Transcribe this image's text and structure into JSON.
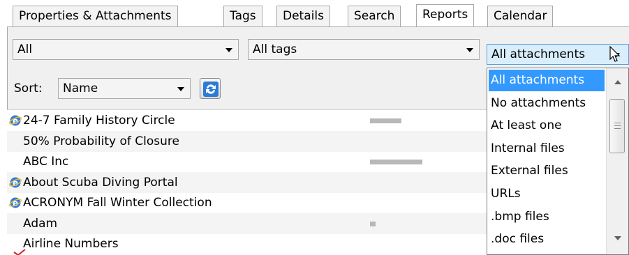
{
  "tabs": [
    {
      "label": "Properties & Attachments",
      "active": false
    },
    {
      "label": "Tags",
      "active": false
    },
    {
      "label": "Details",
      "active": false
    },
    {
      "label": "Search",
      "active": false
    },
    {
      "label": "Reports",
      "active": true
    },
    {
      "label": "Calendar",
      "active": false
    }
  ],
  "filters": {
    "category": "All",
    "tags": "All tags",
    "attachments": "All attachments"
  },
  "sort": {
    "label": "Sort:",
    "value": "Name"
  },
  "sync_icon": "refresh-arrows-icon",
  "list": [
    {
      "name": "24-7 Family History Circle",
      "icon": "internet-explorer-icon",
      "bar_fraction": 0.45
    },
    {
      "name": "50% Probability of Closure",
      "icon": null,
      "bar_fraction": 0
    },
    {
      "name": "ABC Inc",
      "icon": null,
      "bar_fraction": 0.75
    },
    {
      "name": "About Scuba Diving Portal",
      "icon": "internet-explorer-icon",
      "bar_fraction": 0
    },
    {
      "name": "ACRONYM Fall Winter Collection",
      "icon": "internet-explorer-icon",
      "bar_fraction": 0
    },
    {
      "name": "Adam",
      "icon": null,
      "bar_fraction": 0.08
    },
    {
      "name": "Airline Numbers",
      "icon": null,
      "bar_fraction": 0
    }
  ],
  "dropdown_options": [
    {
      "label": "All attachments",
      "selected": true
    },
    {
      "label": "No attachments",
      "selected": false
    },
    {
      "label": "At least one",
      "selected": false
    },
    {
      "label": "Internal files",
      "selected": false
    },
    {
      "label": "External files",
      "selected": false
    },
    {
      "label": "URLs",
      "selected": false
    },
    {
      "label": ".bmp files",
      "selected": false
    },
    {
      "label": ".doc files",
      "selected": false
    }
  ],
  "colors": {
    "selection": "#3399ff",
    "focused_combo": "#d9eefc",
    "panel": "#f0f0f0"
  }
}
